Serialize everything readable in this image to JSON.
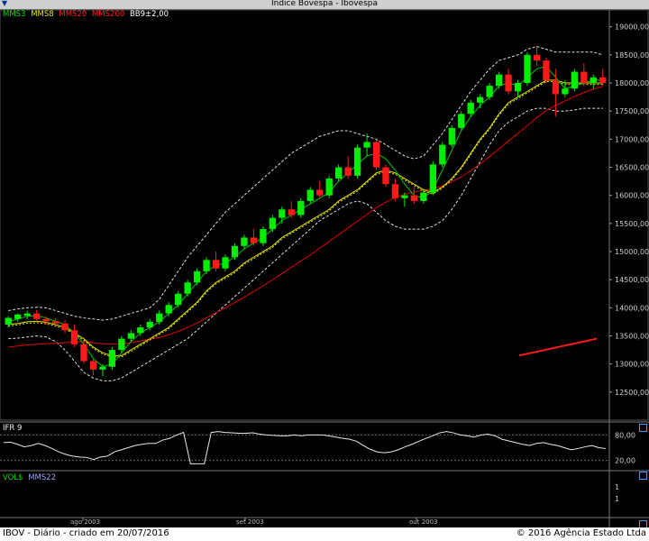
{
  "window": {
    "title": "Indice Bovespa - Ibovespa"
  },
  "legend": [
    {
      "label": "MMS3",
      "color": "#00e000"
    },
    {
      "label": "MMS8",
      "color": "#e6e600"
    },
    {
      "label": "MMS20",
      "color": "#ff2020"
    },
    {
      "label": "MMS200",
      "color": "#ff2020"
    },
    {
      "label": "BB9±2,00",
      "color": "#ffffff"
    }
  ],
  "panels": {
    "ifr": {
      "label": "IFR 9",
      "levels": [
        "80,00",
        "20,00"
      ]
    },
    "vol": {
      "label": "VOL$",
      "ma_label": "MMS22",
      "ticks": [
        "1",
        "1"
      ]
    }
  },
  "x_labels": [
    "ago 2003",
    "set 2003",
    "out 2003"
  ],
  "footer": {
    "left": "IBOV - Diário - criado em 20/07/2016",
    "right": "© 2016 Agência Estado Ltda"
  },
  "chart_data": [
    {
      "type": "candlestick",
      "title": "Indice Bovespa - Ibovespa",
      "ylim": [
        12000,
        19300
      ],
      "y_ticks": [
        12500,
        13000,
        13500,
        14000,
        14500,
        15000,
        15500,
        16000,
        16500,
        17000,
        17500,
        18000,
        18500,
        19000
      ],
      "y_tick_labels": [
        "12500,00",
        "13000,00",
        "13500,00",
        "14000,00",
        "14500,00",
        "15000,00",
        "15500,00",
        "16000,00",
        "16500,00",
        "17000,00",
        "17500,00",
        "18000,00",
        "18500,00",
        "19000,00"
      ],
      "candles": [
        [
          13700,
          13850,
          13650,
          13820
        ],
        [
          13800,
          13900,
          13750,
          13880
        ],
        [
          13860,
          13950,
          13800,
          13900
        ],
        [
          13900,
          13960,
          13780,
          13800
        ],
        [
          13800,
          13850,
          13700,
          13760
        ],
        [
          13760,
          13820,
          13680,
          13720
        ],
        [
          13720,
          13780,
          13550,
          13600
        ],
        [
          13600,
          13700,
          13300,
          13350
        ],
        [
          13350,
          13400,
          13000,
          13050
        ],
        [
          13050,
          13100,
          12800,
          12900
        ],
        [
          12900,
          13000,
          12780,
          12950
        ],
        [
          12950,
          13300,
          12900,
          13250
        ],
        [
          13250,
          13500,
          13200,
          13450
        ],
        [
          13450,
          13600,
          13400,
          13550
        ],
        [
          13550,
          13700,
          13500,
          13650
        ],
        [
          13650,
          13800,
          13600,
          13750
        ],
        [
          13750,
          13950,
          13700,
          13900
        ],
        [
          13900,
          14100,
          13850,
          14050
        ],
        [
          14050,
          14300,
          14000,
          14250
        ],
        [
          14250,
          14500,
          14200,
          14450
        ],
        [
          14450,
          14700,
          14400,
          14650
        ],
        [
          14650,
          14900,
          14600,
          14850
        ],
        [
          14850,
          15000,
          14650,
          14700
        ],
        [
          14700,
          14950,
          14650,
          14900
        ],
        [
          14900,
          15150,
          14850,
          15100
        ],
        [
          15100,
          15300,
          15050,
          15250
        ],
        [
          15250,
          15400,
          15100,
          15150
        ],
        [
          15150,
          15450,
          15100,
          15400
        ],
        [
          15400,
          15650,
          15350,
          15600
        ],
        [
          15600,
          15800,
          15500,
          15750
        ],
        [
          15750,
          15900,
          15600,
          15650
        ],
        [
          15650,
          15950,
          15600,
          15900
        ],
        [
          15900,
          16150,
          15850,
          16100
        ],
        [
          16100,
          16250,
          15950,
          16000
        ],
        [
          16000,
          16350,
          15950,
          16300
        ],
        [
          16300,
          16550,
          16250,
          16500
        ],
        [
          16500,
          16700,
          16300,
          16350
        ],
        [
          16350,
          16900,
          16300,
          16850
        ],
        [
          16850,
          17100,
          16700,
          16950
        ],
        [
          16950,
          17000,
          16450,
          16500
        ],
        [
          16500,
          16550,
          16150,
          16200
        ],
        [
          16200,
          16300,
          15900,
          15950
        ],
        [
          15950,
          16050,
          15800,
          16000
        ],
        [
          16000,
          16150,
          15850,
          15900
        ],
        [
          15900,
          16100,
          15850,
          16050
        ],
        [
          16050,
          16600,
          16000,
          16550
        ],
        [
          16550,
          16950,
          16500,
          16900
        ],
        [
          16900,
          17250,
          16850,
          17200
        ],
        [
          17200,
          17500,
          17150,
          17450
        ],
        [
          17450,
          17700,
          17400,
          17650
        ],
        [
          17650,
          17800,
          17550,
          17750
        ],
        [
          17750,
          18000,
          17700,
          17950
        ],
        [
          17950,
          18200,
          17900,
          18150
        ],
        [
          18150,
          18250,
          17800,
          17850
        ],
        [
          17850,
          18050,
          17750,
          18000
        ],
        [
          18000,
          18550,
          17950,
          18500
        ],
        [
          18500,
          18650,
          18300,
          18400
        ],
        [
          18400,
          18450,
          18000,
          18050
        ],
        [
          18050,
          18250,
          17400,
          17800
        ],
        [
          17800,
          18050,
          17750,
          17900
        ],
        [
          17900,
          18250,
          17850,
          18200
        ],
        [
          18200,
          18350,
          17950,
          18000
        ],
        [
          18000,
          18150,
          17900,
          18100
        ],
        [
          18100,
          18250,
          17950,
          18000
        ]
      ],
      "bollinger_upper": [
        13950,
        13980,
        14000,
        14010,
        14000,
        13950,
        13900,
        13850,
        13820,
        13800,
        13780,
        13800,
        13850,
        13900,
        13950,
        14000,
        14150,
        14400,
        14650,
        14900,
        15100,
        15300,
        15500,
        15700,
        15850,
        16000,
        16150,
        16300,
        16450,
        16600,
        16750,
        16850,
        16950,
        17050,
        17100,
        17150,
        17150,
        17100,
        17050,
        17000,
        16900,
        16800,
        16700,
        16650,
        16700,
        16900,
        17100,
        17350,
        17600,
        17850,
        18050,
        18250,
        18400,
        18450,
        18500,
        18600,
        18650,
        18600,
        18550,
        18550,
        18550,
        18550,
        18550,
        18500
      ],
      "bollinger_lower": [
        13450,
        13460,
        13480,
        13500,
        13480,
        13400,
        13250,
        13050,
        12850,
        12750,
        12700,
        12700,
        12750,
        12850,
        12950,
        13050,
        13150,
        13250,
        13350,
        13450,
        13600,
        13750,
        13900,
        14050,
        14200,
        14350,
        14500,
        14650,
        14800,
        14950,
        15100,
        15250,
        15400,
        15550,
        15650,
        15750,
        15850,
        15900,
        15850,
        15700,
        15550,
        15450,
        15400,
        15400,
        15400,
        15450,
        15550,
        15750,
        16000,
        16300,
        16600,
        16900,
        17150,
        17300,
        17400,
        17500,
        17550,
        17550,
        17500,
        17500,
        17520,
        17550,
        17550,
        17550
      ],
      "ma_fast": [
        13750,
        13800,
        13850,
        13860,
        13820,
        13760,
        13700,
        13550,
        13350,
        13100,
        12950,
        13000,
        13200,
        13400,
        13550,
        13650,
        13750,
        13900,
        14050,
        14250,
        14450,
        14650,
        14750,
        14800,
        14900,
        15050,
        15150,
        15250,
        15400,
        15550,
        15650,
        15750,
        15850,
        15950,
        16050,
        16250,
        16400,
        16550,
        16700,
        16750,
        16650,
        16450,
        16200,
        16000,
        15950,
        16100,
        16450,
        16800,
        17150,
        17400,
        17600,
        17750,
        17950,
        18000,
        17950,
        18100,
        18250,
        18300,
        18100,
        17900,
        17950,
        18000,
        18050,
        18050
      ],
      "ma_slow": [
        13700,
        13720,
        13750,
        13760,
        13740,
        13700,
        13650,
        13550,
        13450,
        13300,
        13200,
        13150,
        13150,
        13250,
        13350,
        13450,
        13550,
        13650,
        13800,
        13950,
        14100,
        14300,
        14450,
        14550,
        14650,
        14800,
        14900,
        15000,
        15100,
        15250,
        15350,
        15450,
        15550,
        15650,
        15750,
        15900,
        16000,
        16100,
        16250,
        16400,
        16450,
        16400,
        16300,
        16200,
        16100,
        16050,
        16150,
        16300,
        16500,
        16750,
        17000,
        17200,
        17450,
        17650,
        17750,
        17850,
        17950,
        18050,
        18050,
        18000,
        18000,
        18000,
        18000,
        18000
      ],
      "ma_20": [
        13300,
        13320,
        13340,
        13350,
        13360,
        13370,
        13380,
        13390,
        13400,
        13380,
        13360,
        13350,
        13360,
        13380,
        13410,
        13440,
        13470,
        13520,
        13580,
        13650,
        13730,
        13820,
        13910,
        14000,
        14090,
        14190,
        14290,
        14390,
        14500,
        14610,
        14720,
        14830,
        14940,
        15060,
        15180,
        15300,
        15420,
        15540,
        15660,
        15780,
        15880,
        15960,
        16020,
        16060,
        16090,
        16120,
        16170,
        16240,
        16330,
        16440,
        16560,
        16690,
        16830,
        16970,
        17100,
        17240,
        17380,
        17510,
        17600,
        17680,
        17760,
        17830,
        17890,
        17940
      ],
      "trendline": [
        [
          13150,
          13450
        ]
      ]
    },
    {
      "type": "line",
      "title": "IFR 9",
      "ylim": [
        0,
        100
      ],
      "reference_levels": [
        80,
        20
      ],
      "values": [
        62,
        63,
        58,
        52,
        55,
        60,
        55,
        48,
        40,
        34,
        30,
        28,
        27,
        22,
        28,
        30,
        40,
        45,
        50,
        55,
        58,
        60,
        60,
        68,
        72,
        80,
        86,
        12,
        12,
        12,
        86,
        88,
        86,
        85,
        84,
        84,
        85,
        82,
        80,
        79,
        78,
        78,
        80,
        78,
        80,
        80,
        80,
        78,
        75,
        72,
        70,
        65,
        55,
        46,
        40,
        38,
        40,
        45,
        52,
        58,
        65,
        72,
        78,
        85,
        88,
        85,
        80,
        78,
        75,
        80,
        82,
        78,
        70,
        66,
        62,
        58,
        55,
        60,
        62,
        58,
        55,
        50,
        45,
        48,
        52,
        55,
        50,
        48
      ],
      "y_tick_labels": [
        "80,00",
        "20,00"
      ]
    },
    {
      "type": "bar",
      "title": "VOL$",
      "series": [
        {
          "name": "MMS22",
          "values": []
        }
      ],
      "y_tick_labels": [
        "1",
        "1"
      ]
    }
  ]
}
